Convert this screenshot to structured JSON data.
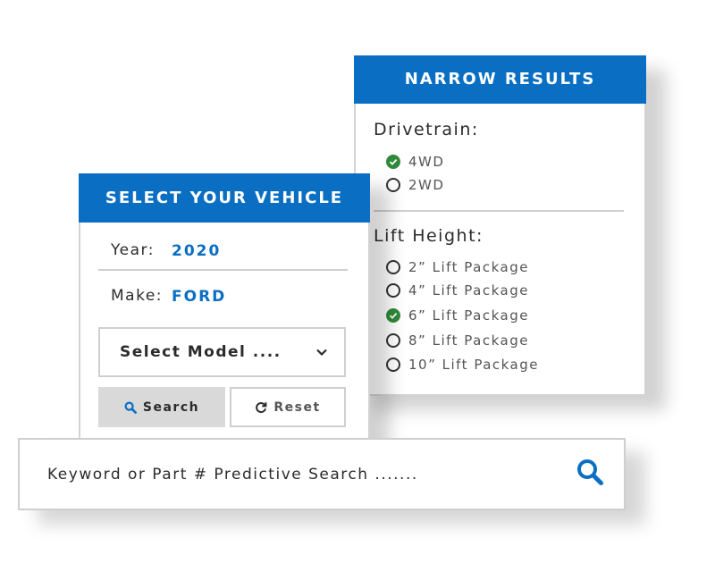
{
  "narrow": {
    "title": "NARROW RESULTS",
    "drivetrain": {
      "label": "Drivetrain:",
      "options": [
        {
          "label": "4WD",
          "checked": true
        },
        {
          "label": "2WD",
          "checked": false
        }
      ]
    },
    "lift": {
      "label": "Lift Height:",
      "options": [
        {
          "label": "2” Lift Package",
          "checked": false
        },
        {
          "label": "4” Lift Package",
          "checked": false
        },
        {
          "label": "6” Lift Package",
          "checked": true
        },
        {
          "label": "8” Lift Package",
          "checked": false
        },
        {
          "label": "10” Lift Package",
          "checked": false
        }
      ]
    }
  },
  "vehicle": {
    "title": "SELECT YOUR VEHICLE",
    "year_label": "Year:",
    "year_value": "2020",
    "make_label": "Make:",
    "make_value": "FORD",
    "model_placeholder": "Select Model ....",
    "search_label": "Search",
    "reset_label": "Reset"
  },
  "keyword": {
    "placeholder": "Keyword or Part # Predictive Search ......."
  },
  "colors": {
    "accent": "#0a6fc2",
    "check_green": "#2f8a3a",
    "border": "#cfcfcf"
  }
}
